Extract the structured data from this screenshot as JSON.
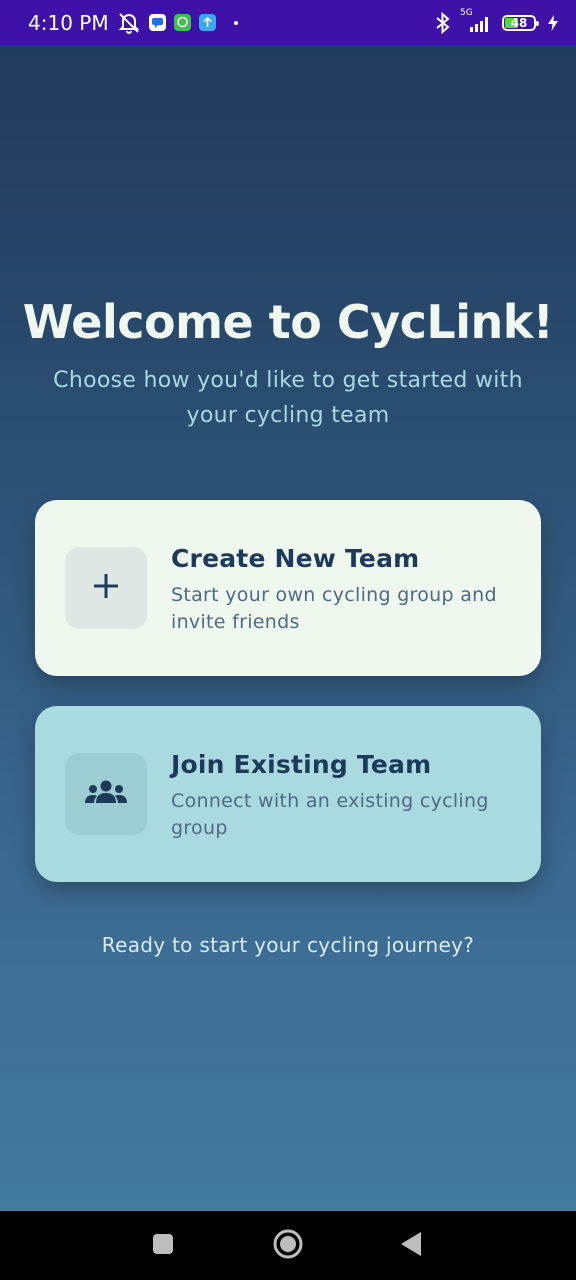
{
  "status_bar": {
    "time": "4:10 PM",
    "network": "5G",
    "battery_level": "48",
    "battery_fraction": 0.48,
    "icons": [
      "mute-icon",
      "messages-app-icon",
      "chat-app-icon",
      "upload-app-icon",
      "notification-dot-icon",
      "bluetooth-icon",
      "signal-icon",
      "battery-icon",
      "charging-icon"
    ]
  },
  "welcome": {
    "title": "Welcome to CycLink!",
    "subtitle": "Choose how you'd like to get started with your cycling team"
  },
  "options": {
    "create": {
      "title": "Create New Team",
      "description": "Start your own cycling group and invite friends",
      "icon": "plus-icon"
    },
    "join": {
      "title": "Join Existing Team",
      "description": "Connect with an existing cycling group",
      "icon": "group-icon"
    }
  },
  "footer": {
    "text": "Ready to start your cycling journey?"
  },
  "nav_bar": {
    "icons": [
      "recent-apps-icon",
      "home-icon",
      "back-icon"
    ]
  },
  "colors": {
    "status_bar": "#3e12a8",
    "background_top": "#203a5b",
    "background_bottom": "#437a9f",
    "create_card": "#eff8ee",
    "join_card": "#a9dadf",
    "heading_text": "#1e3a5a"
  }
}
